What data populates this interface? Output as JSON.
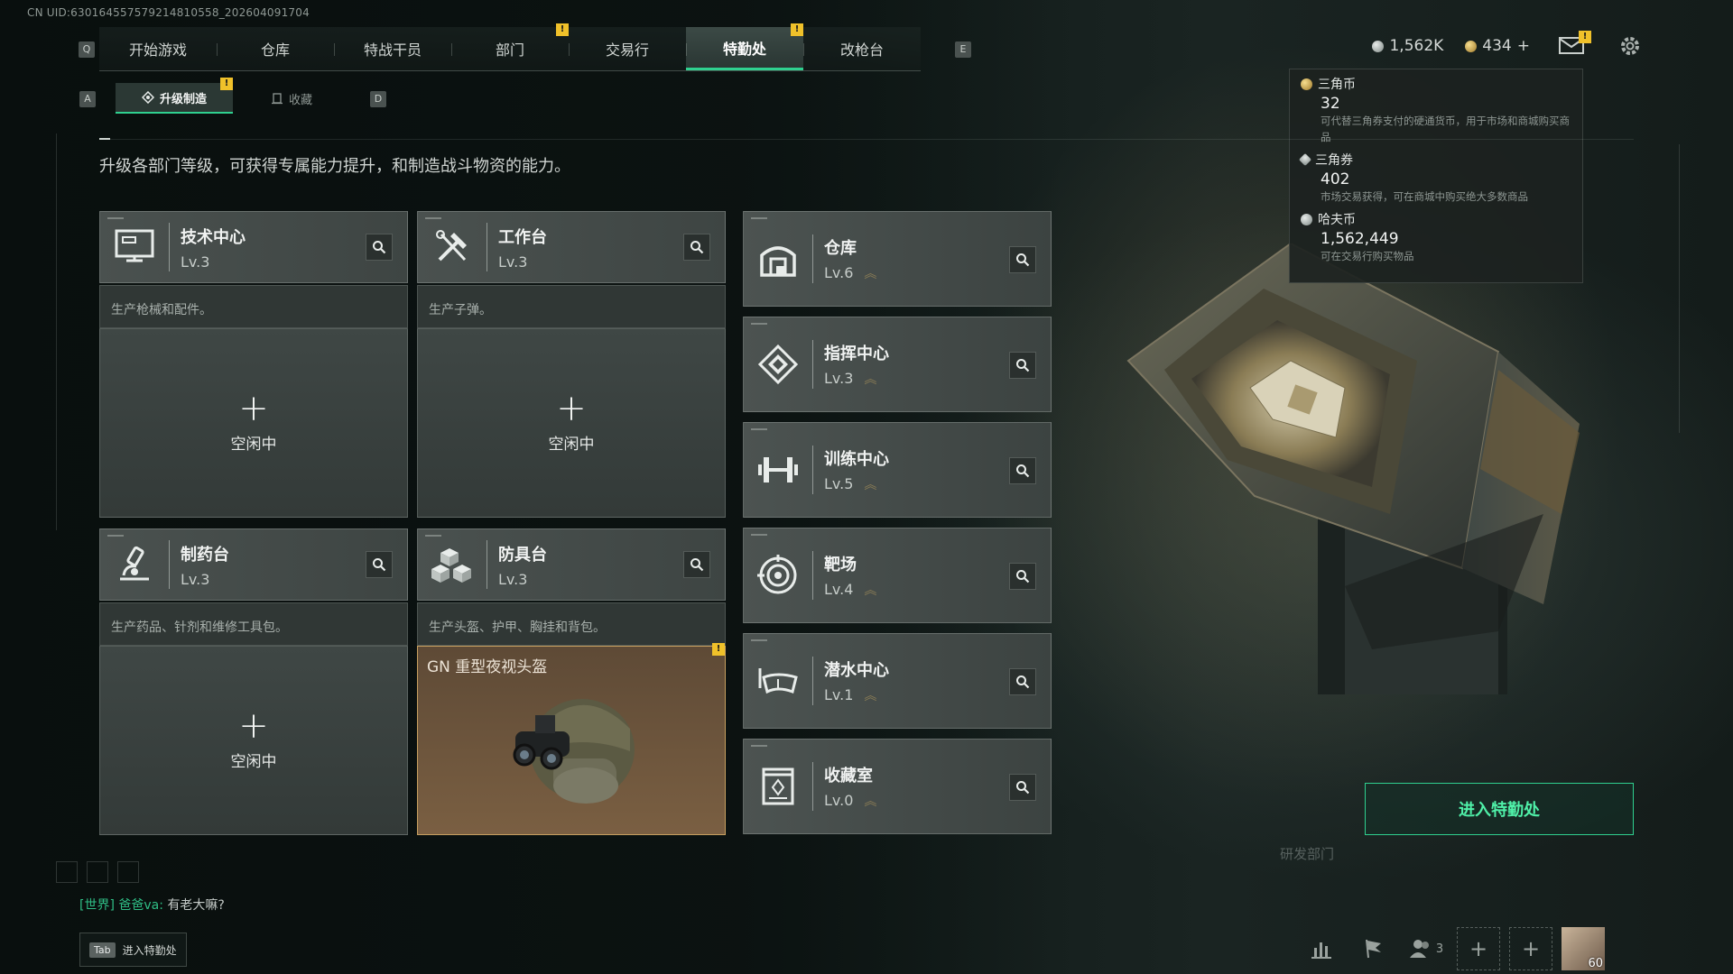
{
  "uid": "CN UID:630164557579214810558_202604091704",
  "nav": {
    "q_key": "Q",
    "e_key": "E",
    "tabs": [
      {
        "label": "开始游戏",
        "badge": ""
      },
      {
        "label": "仓库",
        "badge": ""
      },
      {
        "label": "特战干员",
        "badge": ""
      },
      {
        "label": "部门",
        "badge": "!"
      },
      {
        "label": "交易行",
        "badge": ""
      },
      {
        "label": "特勤处",
        "badge": "!",
        "active": true
      },
      {
        "label": "改枪台",
        "badge": ""
      }
    ]
  },
  "currency": {
    "silver": "1,562K",
    "gold": "434",
    "gold_add": "+",
    "mail_badge": "!"
  },
  "currency_tip": [
    {
      "name": "三角币",
      "amount": "32",
      "desc": "可代替三角券支付的硬通货币，用于市场和商城购买商品"
    },
    {
      "name": "三角券",
      "amount": "402",
      "desc": "市场交易获得，可在商城中购买绝大多数商品"
    },
    {
      "name": "哈夫币",
      "amount": "1,562,449",
      "desc": "可在交易行购买物品"
    }
  ],
  "subtabs": {
    "a_key": "A",
    "d_key": "D",
    "items": [
      {
        "label": "升级制造",
        "badge": "!",
        "active": true
      },
      {
        "label": "收藏",
        "badge": ""
      }
    ]
  },
  "description": "升级各部门等级，可获得专属能力提升，和制造战斗物资的能力。",
  "production": [
    {
      "name": "技术中心",
      "level": "Lv.3",
      "desc": "生产枪械和配件。",
      "slot": "空闲中",
      "icon": "computer-icon"
    },
    {
      "name": "工作台",
      "level": "Lv.3",
      "desc": "生产子弹。",
      "slot": "空闲中",
      "icon": "tools-icon"
    },
    {
      "name": "制药台",
      "level": "Lv.3",
      "desc": "生产药品、针剂和维修工具包。",
      "slot": "空闲中",
      "icon": "microscope-icon"
    },
    {
      "name": "防具台",
      "level": "Lv.3",
      "desc": "生产头盔、护甲、胸挂和背包。",
      "slot_item": "GN 重型夜视头盔",
      "slot_badge": "!",
      "icon": "blocks-icon"
    }
  ],
  "departments": [
    {
      "name": "仓库",
      "level": "Lv.6",
      "icon": "warehouse-icon"
    },
    {
      "name": "指挥中心",
      "level": "Lv.3",
      "icon": "command-icon"
    },
    {
      "name": "训练中心",
      "level": "Lv.5",
      "icon": "dumbbell-icon"
    },
    {
      "name": "靶场",
      "level": "Lv.4",
      "icon": "target-icon"
    },
    {
      "name": "潜水中心",
      "level": "Lv.1",
      "icon": "goggles-icon"
    },
    {
      "name": "收藏室",
      "level": "Lv.0",
      "icon": "trophy-icon"
    }
  ],
  "enter_button": "进入特勤处",
  "rd_label": "研发部门",
  "chat": {
    "channel": "[世界]",
    "user": "爸爸va:",
    "message": "有老大嘛?"
  },
  "tab_hint": {
    "key": "Tab",
    "label": "进入特勤处"
  },
  "bottom": {
    "friends_count": "3",
    "avatar_level": "60"
  },
  "colors": {
    "accent": "#2fd08f",
    "badge": "#f0c12a",
    "filled_slot": "#6a5440"
  }
}
